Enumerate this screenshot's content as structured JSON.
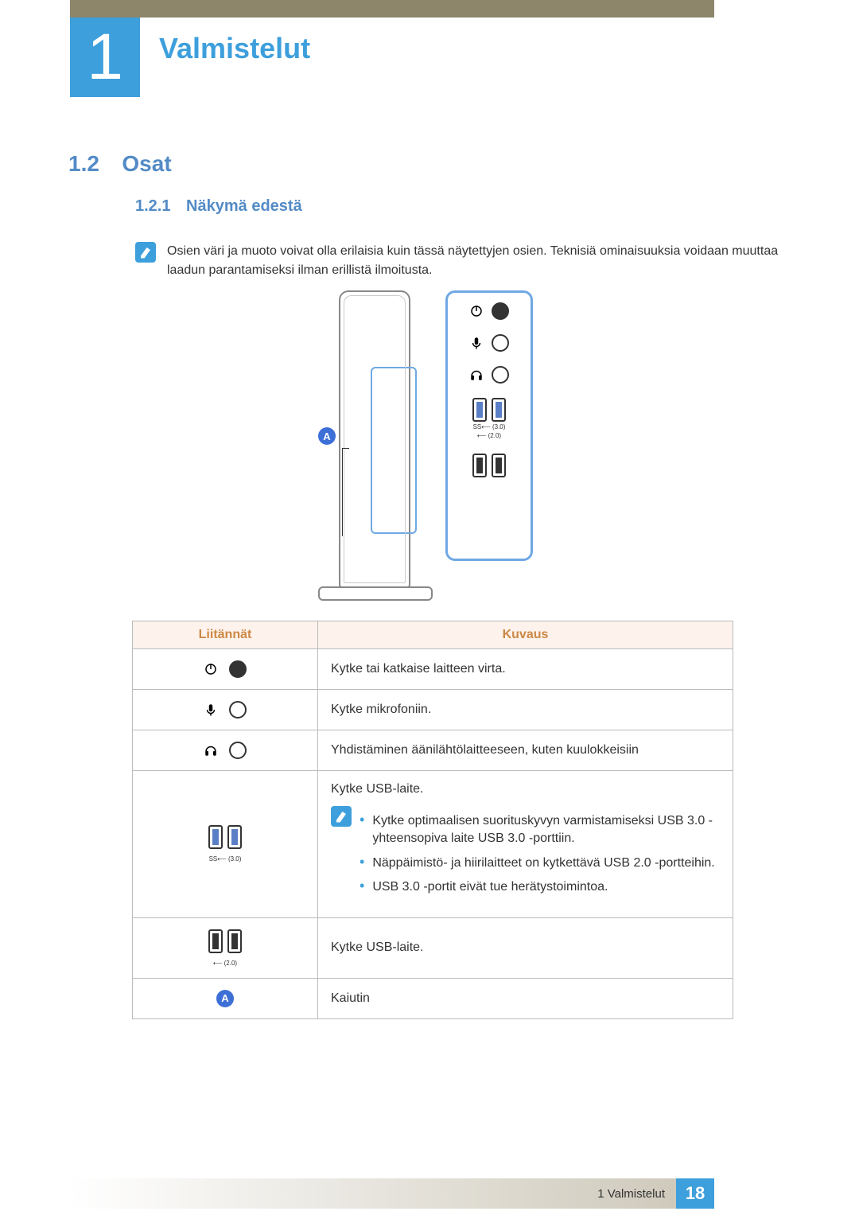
{
  "chapter": {
    "number": "1",
    "title": "Valmistelut"
  },
  "section": {
    "number": "1.2",
    "title": "Osat"
  },
  "subsection": {
    "number": "1.2.1",
    "title": "Näkymä edestä"
  },
  "note_text": "Osien väri ja muoto voivat olla erilaisia kuin tässä näytettyjen osien. Teknisiä ominaisuuksia voidaan muuttaa laadun parantamiseksi ilman erillistä ilmoitusta.",
  "diagram": {
    "callout_A": "A",
    "usb30_label": "(3.0)",
    "usb20_label": "(2.0)"
  },
  "table": {
    "head": {
      "col1": "Liitännät",
      "col2": "Kuvaus"
    },
    "rows": {
      "power": "Kytke tai katkaise laitteen virta.",
      "mic": "Kytke mikrofoniin.",
      "headphones": "Yhdistäminen äänilähtölaitteeseen, kuten kuulokkeisiin",
      "usb30_intro": "Kytke USB-laite.",
      "usb30_bullets": [
        "Kytke optimaalisen suorituskyvyn varmistamiseksi USB 3.0 -yhteensopiva laite USB 3.0 -porttiin.",
        "Näppäimistö- ja hiirilaitteet on kytkettävä USB 2.0 -portteihin.",
        "USB 3.0 -portit eivät tue herätystoimintoa."
      ],
      "usb20": "Kytke USB-laite.",
      "speaker": "Kaiutin",
      "usb30_lbl": "(3.0)",
      "usb20_lbl": "(2.0)"
    }
  },
  "footer": {
    "chapter_ref": "1 Valmistelut",
    "page": "18"
  }
}
